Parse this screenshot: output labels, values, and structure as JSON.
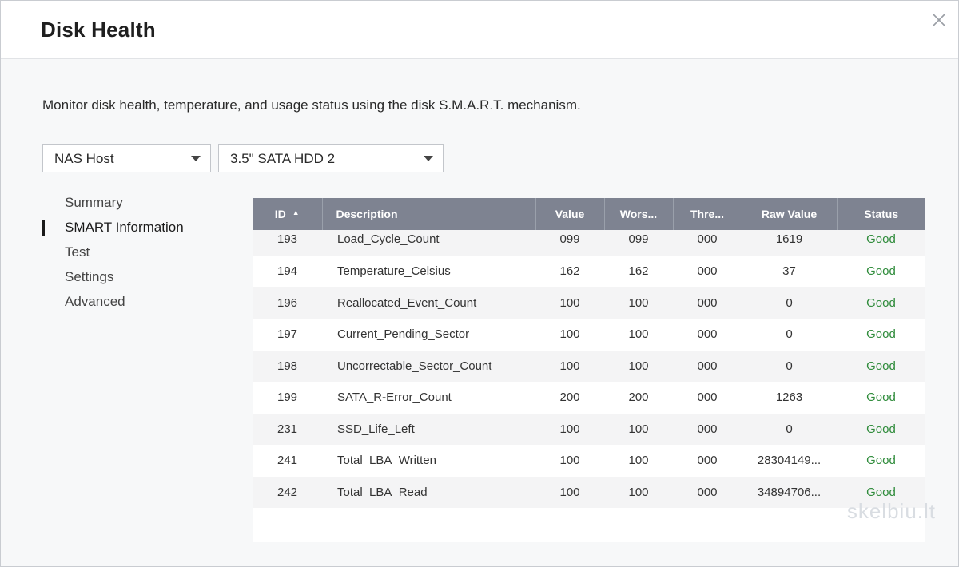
{
  "dialog": {
    "title": "Disk Health",
    "description": "Monitor disk health, temperature, and usage status using the disk S.M.A.R.T. mechanism."
  },
  "selectors": {
    "host": "NAS Host",
    "disk": "3.5\" SATA HDD 2"
  },
  "sidebar": {
    "items": [
      {
        "label": "Summary"
      },
      {
        "label": "SMART Information",
        "active": true
      },
      {
        "label": "Test"
      },
      {
        "label": "Settings"
      },
      {
        "label": "Advanced"
      }
    ]
  },
  "table": {
    "columns": [
      "ID",
      "Description",
      "Value",
      "Wors...",
      "Thre...",
      "Raw Value",
      "Status"
    ],
    "rows": [
      [
        "193",
        "Load_Cycle_Count",
        "099",
        "099",
        "000",
        "1619",
        "Good"
      ],
      [
        "194",
        "Temperature_Celsius",
        "162",
        "162",
        "000",
        "37",
        "Good"
      ],
      [
        "196",
        "Reallocated_Event_Count",
        "100",
        "100",
        "000",
        "0",
        "Good"
      ],
      [
        "197",
        "Current_Pending_Sector",
        "100",
        "100",
        "000",
        "0",
        "Good"
      ],
      [
        "198",
        "Uncorrectable_Sector_Count",
        "100",
        "100",
        "000",
        "0",
        "Good"
      ],
      [
        "199",
        "SATA_R-Error_Count",
        "200",
        "200",
        "000",
        "1263",
        "Good"
      ],
      [
        "231",
        "SSD_Life_Left",
        "100",
        "100",
        "000",
        "0",
        "Good"
      ],
      [
        "241",
        "Total_LBA_Written",
        "100",
        "100",
        "000",
        "28304149...",
        "Good"
      ],
      [
        "242",
        "Total_LBA_Read",
        "100",
        "100",
        "000",
        "34894706...",
        "Good"
      ]
    ]
  },
  "watermark": "skelbiu.lt",
  "colors": {
    "header_bg": "#7e8391",
    "status_good": "#2e8b3a"
  }
}
